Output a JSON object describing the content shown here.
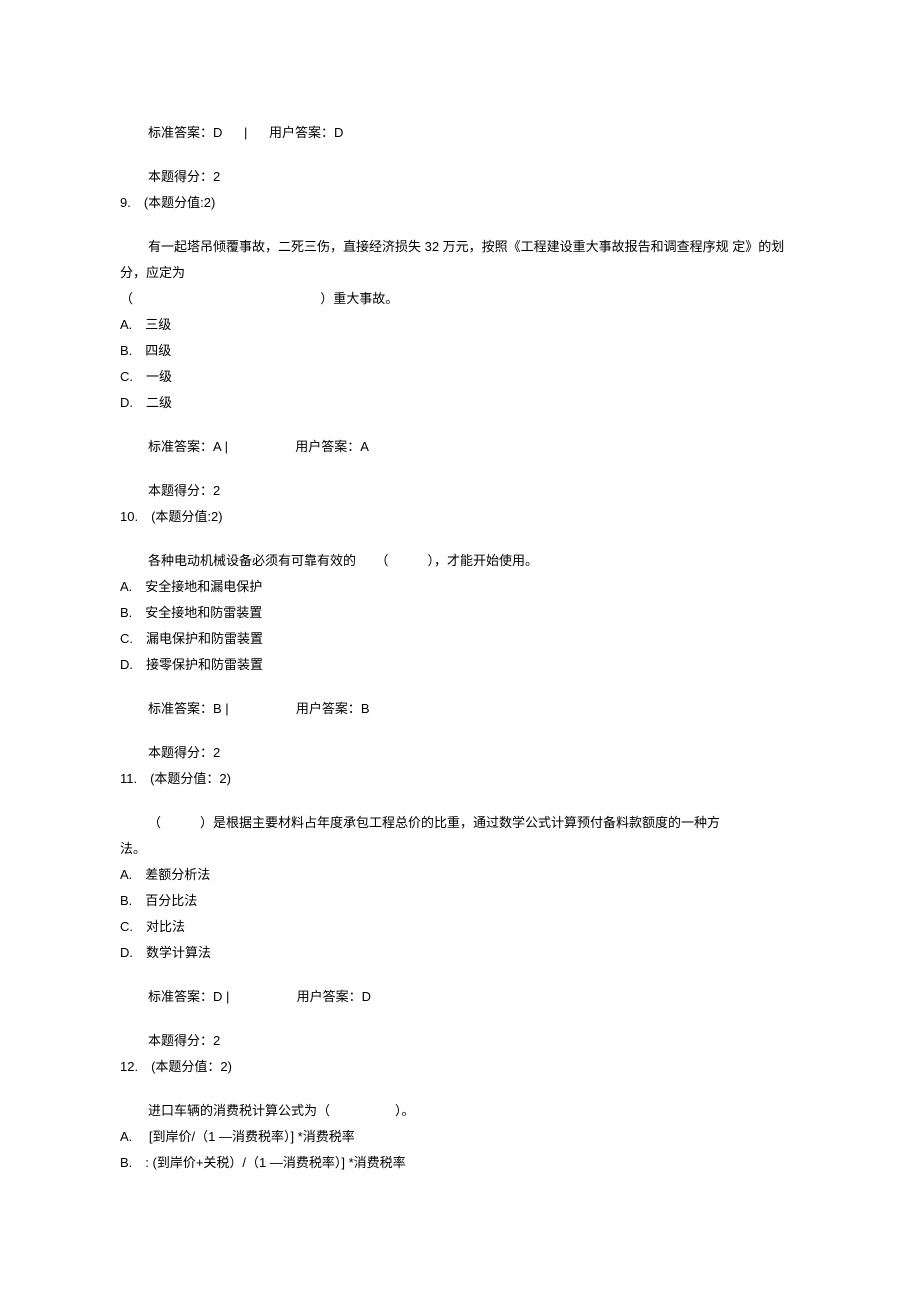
{
  "q8": {
    "std_label": "标准答案：D",
    "sep": "|",
    "usr_label": "用户答案：D",
    "score": "本题得分：2"
  },
  "q9": {
    "header": "9.　(本题分值:2)",
    "stem_line1": "有一起塔吊倾覆事故，二死三伤，直接经济损失 32 万元，按照《工程建设重大事故报告和调查程序规 定》的划分，应定为",
    "stem_line2_prefix": "（",
    "stem_line2_suffix": "）重大事故。",
    "optA": "A.　三级",
    "optB": "B.　四级",
    "optC": "C.　一级",
    "optD": "D.　二级",
    "std_label": "标准答案：A |",
    "usr_label": "用户答案：A",
    "score": "本题得分：2"
  },
  "q10": {
    "header": "10.　(本题分值:2)",
    "stem": "各种电动机械设备必须有可靠有效的　　（　　　），才能开始使用。",
    "optA": "A.　安全接地和漏电保护",
    "optB": "B.　安全接地和防雷装置",
    "optC": "C.　漏电保护和防雷装置",
    "optD": "D.　接零保护和防雷装置",
    "std_label": "标准答案：B |",
    "usr_label": "用户答案：B",
    "score": "本题得分：2"
  },
  "q11": {
    "header": "11.　(本题分值：2)",
    "stem_line1": "（　　　）是根据主要材料占年度承包工程总价的比重，通过数学公式计算预付备料款额度的一种方",
    "stem_line2": "法。",
    "optA": "A.　差额分析法",
    "optB": "B.　百分比法",
    "optC": "C.　对比法",
    "optD": "D.　数学计算法",
    "std_label": "标准答案：D |",
    "usr_label": "用户答案：D",
    "score": "本题得分：2"
  },
  "q12": {
    "header": "12.　(本题分值：2)",
    "stem": "进口车辆的消费税计算公式为（　　　　　）。",
    "optA": "A.　 [到岸价/（1 —消费税率）]  *消费税率",
    "optB": "B.　: (到岸价+关税）/（1 —消费税率）]  *消费税率"
  }
}
